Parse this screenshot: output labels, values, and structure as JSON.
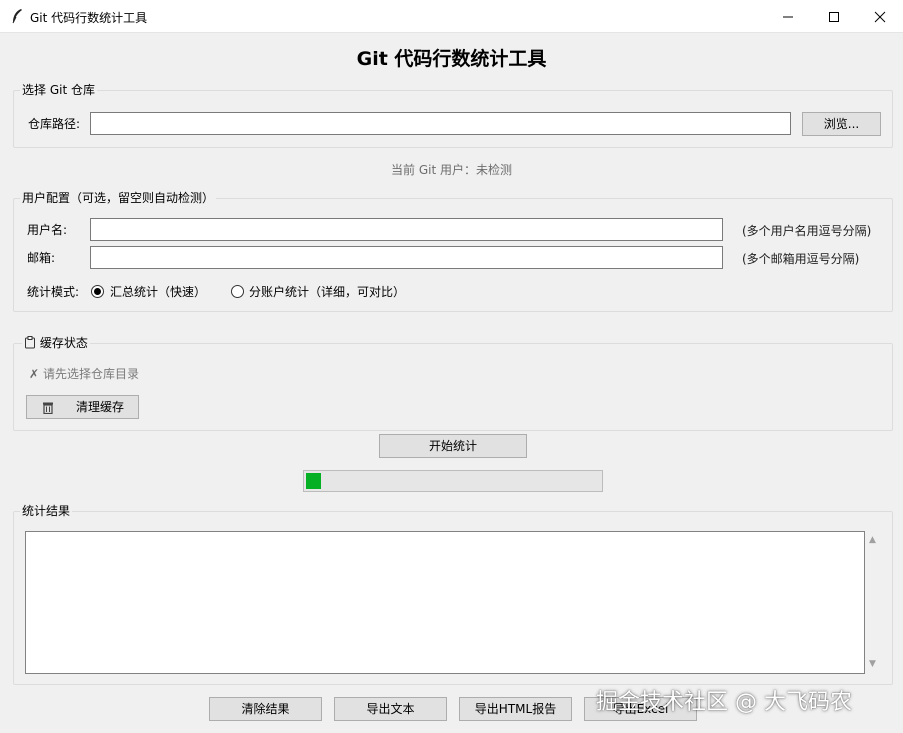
{
  "window": {
    "title": "Git 代码行数统计工具",
    "controls": {
      "minimize": "minimize-icon",
      "maximize": "maximize-icon",
      "close": "close-icon"
    }
  },
  "heading": "Git 代码行数统计工具",
  "repo_group": {
    "legend": "选择 Git 仓库",
    "path_label": "仓库路径:",
    "path_value": "",
    "browse_label": "浏览..."
  },
  "current_user": "当前 Git 用户：未检测",
  "user_group": {
    "legend": "用户配置（可选，留空则自动检测）",
    "username_label": "用户名:",
    "username_value": "",
    "username_hint": "(多个用户名用逗号分隔)",
    "email_label": "邮箱:",
    "email_value": "",
    "email_hint": "(多个邮箱用逗号分隔)",
    "mode_label": "统计模式:",
    "modes": [
      {
        "label": "汇总统计（快速）",
        "selected": true
      },
      {
        "label": "分账户统计（详细，可对比）",
        "selected": false
      }
    ]
  },
  "cache_group": {
    "legend_icon": "clipboard-icon",
    "legend": "缓存状态",
    "status_icon": "x-mark-icon",
    "status_mark": "✗",
    "status_text": "请先选择仓库目录",
    "clear_icon": "trash-icon",
    "clear_label": "清理缓存"
  },
  "start_button": "开始统计",
  "progress": {
    "value_percent": 5,
    "color": "#06b025"
  },
  "results_group": {
    "legend": "统计结果",
    "content": ""
  },
  "bottom_buttons": {
    "clear": "清除结果",
    "export_text": "导出文本",
    "export_html": "导出HTML报告",
    "export_excel": "导出Excel"
  },
  "watermark": "掘金技术社区 @ 大飞码农"
}
